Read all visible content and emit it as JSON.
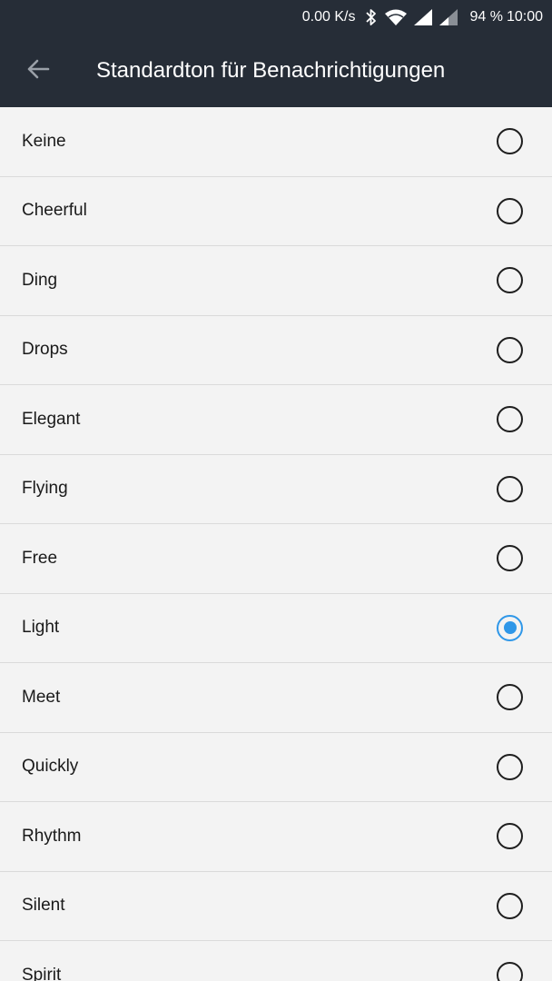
{
  "status_bar": {
    "net_speed": "0.00 K/s",
    "battery": "94 %",
    "time": "10:00",
    "icons": [
      "bluetooth-icon",
      "wifi-icon",
      "signal-icon",
      "signal-icon"
    ]
  },
  "app_bar": {
    "title": "Standardton für Benachrichtigungen",
    "back_icon": "arrow-left-icon"
  },
  "colors": {
    "bar_bg": "#262d37",
    "list_bg": "#f3f3f3",
    "accent": "#2f97e8"
  },
  "options": [
    {
      "label": "Keine",
      "selected": false
    },
    {
      "label": "Cheerful",
      "selected": false
    },
    {
      "label": "Ding",
      "selected": false
    },
    {
      "label": "Drops",
      "selected": false
    },
    {
      "label": "Elegant",
      "selected": false
    },
    {
      "label": "Flying",
      "selected": false
    },
    {
      "label": "Free",
      "selected": false
    },
    {
      "label": "Light",
      "selected": true
    },
    {
      "label": "Meet",
      "selected": false
    },
    {
      "label": "Quickly",
      "selected": false
    },
    {
      "label": "Rhythm",
      "selected": false
    },
    {
      "label": "Silent",
      "selected": false
    },
    {
      "label": "Spirit",
      "selected": false
    }
  ]
}
